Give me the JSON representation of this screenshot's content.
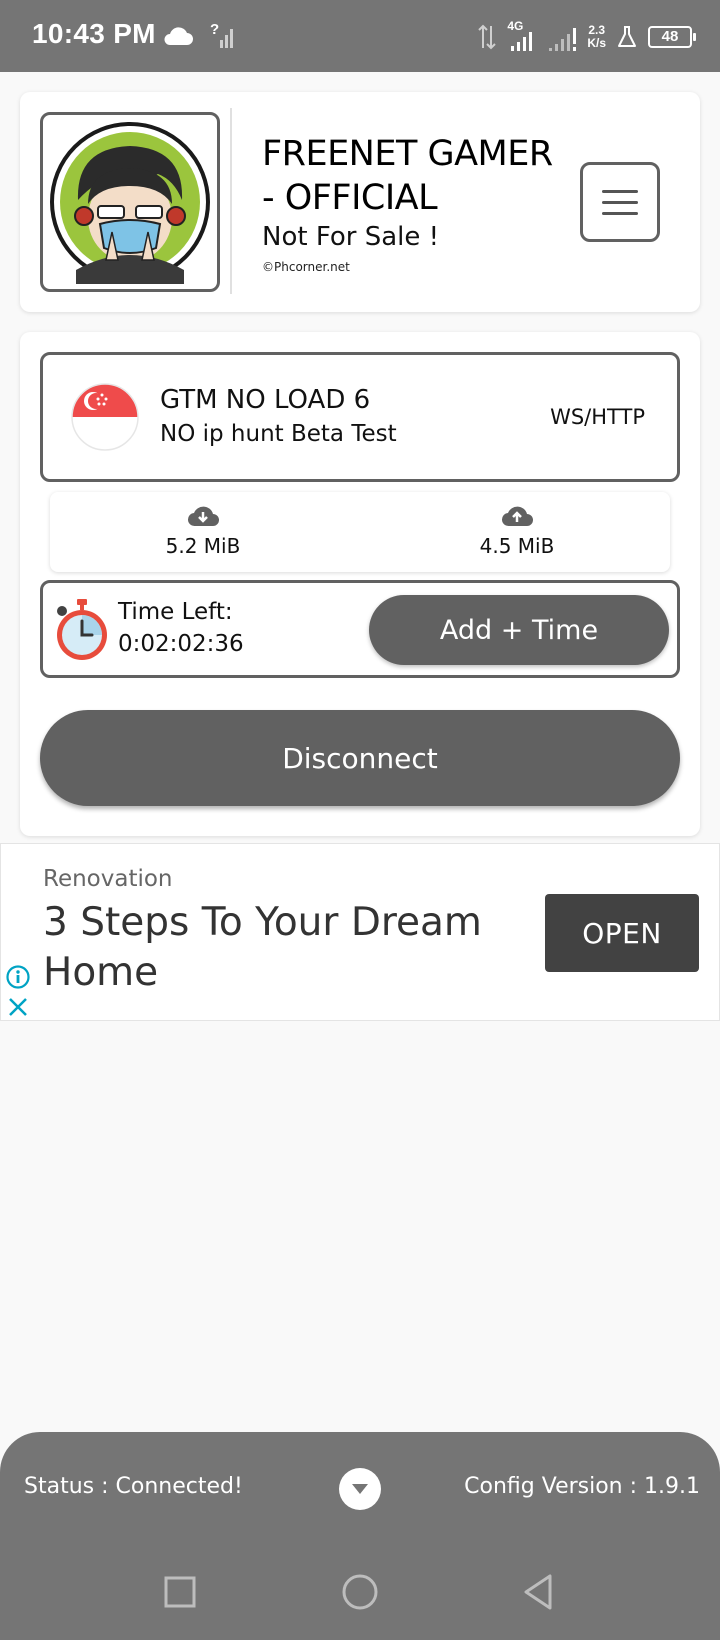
{
  "status_bar": {
    "time": "10:43 PM",
    "network_type": "4G",
    "speed_value": "2.3",
    "speed_unit": "K/s",
    "battery": "48"
  },
  "header": {
    "title": "FREENET GAMER - OFFICIAL",
    "subtitle": "Not For Sale !",
    "credit": "©Phcorner.net",
    "avatar_icon": "avatar-illustration",
    "menu_icon": "hamburger-menu-icon"
  },
  "server": {
    "name": "GTM NO LOAD 6",
    "description": "NO ip hunt Beta Test",
    "protocol": "WS/HTTP",
    "flag_icon": "singapore-flag-icon"
  },
  "traffic": {
    "download": "5.2 MiB",
    "upload": "4.5 MiB"
  },
  "timer": {
    "label": "Time Left:",
    "value": "0:02:02:36",
    "add_button": "Add + Time"
  },
  "disconnect_button": "Disconnect",
  "ad": {
    "category": "Renovation",
    "headline": "3 Steps To Your Dream Home",
    "cta": "OPEN"
  },
  "bottom": {
    "status": "Status :  Connected!",
    "config_version": "Config Version :  1.9.1"
  },
  "colors": {
    "accent": "#616161",
    "status_bar": "#757575",
    "ad_button": "#424242",
    "ad_icon": "#00a3c4",
    "flag_red": "#ef4b4b"
  }
}
